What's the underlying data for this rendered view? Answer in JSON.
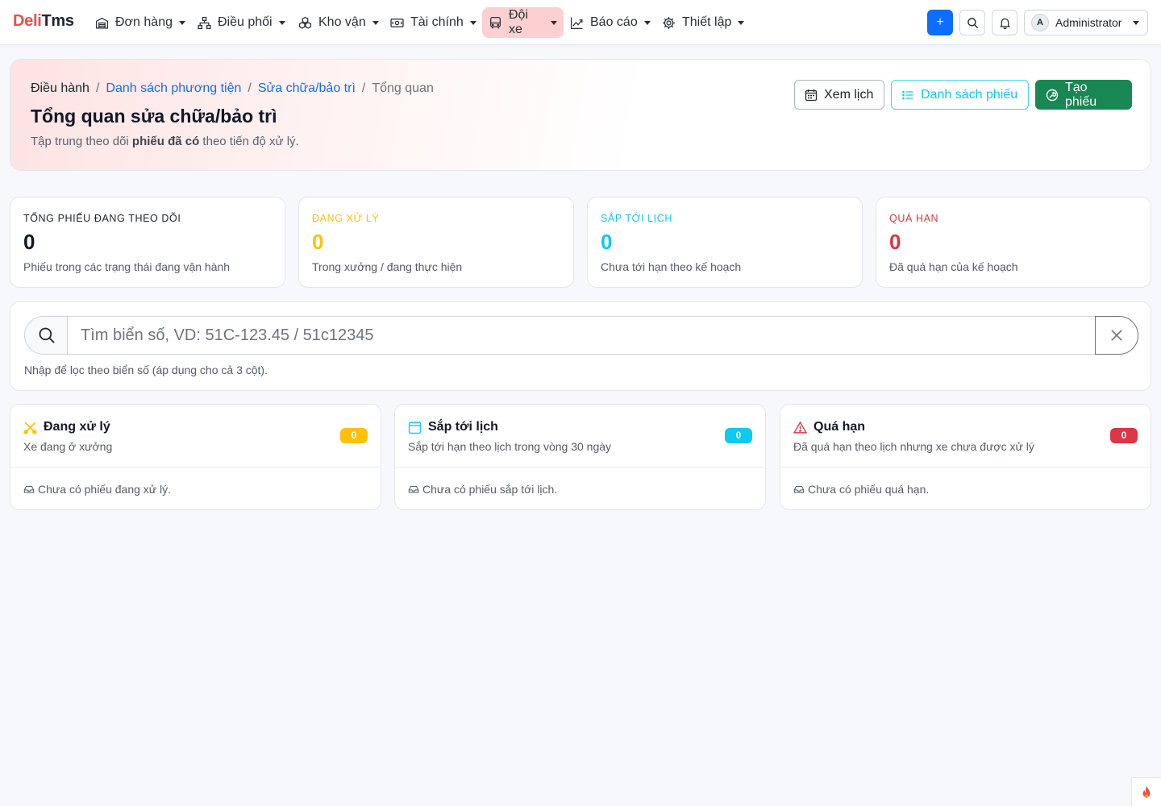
{
  "brand": {
    "part1": "Deli",
    "part2": "Tms"
  },
  "nav": {
    "items": [
      {
        "label": "Đơn hàng",
        "icon": "warehouse-icon"
      },
      {
        "label": "Điều phối",
        "icon": "diagram-icon"
      },
      {
        "label": "Kho vận",
        "icon": "boxes-icon"
      },
      {
        "label": "Tài chính",
        "icon": "cash-icon"
      },
      {
        "label": "Đội xe",
        "icon": "bus-icon",
        "active": true
      },
      {
        "label": "Báo cáo",
        "icon": "graph-up-icon"
      },
      {
        "label": "Thiết lập",
        "icon": "gear-icon"
      }
    ],
    "add_label": "+",
    "user": {
      "initial": "A",
      "name": "Administrator"
    }
  },
  "breadcrumb": {
    "items": [
      "Điều hành",
      "Danh sách phương tiện",
      "Sửa chữa/bảo trì",
      "Tổng quan"
    ],
    "separator": "/"
  },
  "page": {
    "title": "Tổng quan sửa chữa/bảo trì",
    "subtitle_before": "Tập trung theo dõi ",
    "subtitle_bold": "phiếu đã có",
    "subtitle_after": " theo tiến độ xử lý."
  },
  "actions": {
    "calendar_label": "Xem lịch",
    "list_label": "Danh sách phiếu",
    "create_label": "Tạo phiếu"
  },
  "stats": [
    {
      "label": "TỔNG PHIẾU ĐANG THEO DÕI",
      "value": "0",
      "desc": "Phiếu trong các trạng thái đang vận hành",
      "color": "#212529",
      "value_color": "#111827"
    },
    {
      "label": "ĐANG XỬ LÝ",
      "value": "0",
      "desc": "Trong xưởng / đang thực hiện",
      "color": "#ffc107",
      "value_color": "#ffc107"
    },
    {
      "label": "SẮP TỚI LỊCH",
      "value": "0",
      "desc": "Chưa tới hạn theo kế hoạch",
      "color": "#0dcaf0",
      "value_color": "#0dcaf0"
    },
    {
      "label": "QUÁ HẠN",
      "value": "0",
      "desc": "Đã quá hạn của kế hoạch",
      "color": "#dc3545",
      "value_color": "#dc3545"
    }
  ],
  "search": {
    "placeholder": "Tìm biển số, VD: 51C-123.45 / 51c12345",
    "value": "",
    "help": "Nhập để lọc theo biển số (áp dụng cho cả 3 cột)."
  },
  "columns": [
    {
      "title": "Đang xử lý",
      "icon": "tools-icon",
      "subtitle": "Xe đang ở xưởng",
      "count": "0",
      "badge_color": "#ffc107",
      "badge_text_color": "#ffffff",
      "empty": "Chưa có phiếu đang xử lý."
    },
    {
      "title": "Sắp tới lịch",
      "icon": "calendar-icon",
      "subtitle": "Sắp tới hạn theo lịch trong vòng 30 ngày",
      "count": "0",
      "badge_color": "#0dcaf0",
      "badge_text_color": "#ffffff",
      "empty": "Chưa có phiếu sắp tới lịch."
    },
    {
      "title": "Quá hạn",
      "icon": "warning-icon",
      "subtitle": "Đã quá hạn theo lịch nhưng xe chưa được xử lý",
      "count": "0",
      "badge_color": "#dc3545",
      "badge_text_color": "#ffffff",
      "empty": "Chưa có phiếu quá hạn."
    }
  ]
}
